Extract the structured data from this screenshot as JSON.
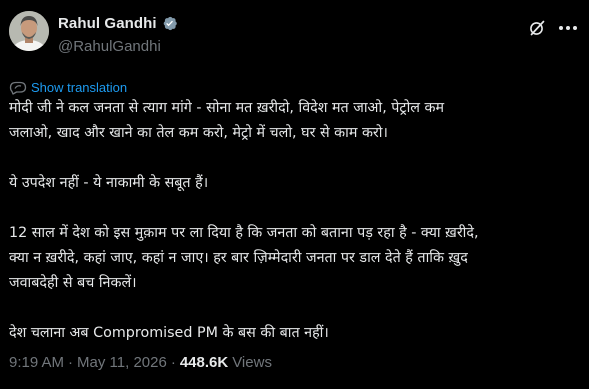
{
  "author": {
    "display_name": "Rahul Gandhi",
    "handle": "@RahulGandhi",
    "verified": true
  },
  "translate": {
    "label": "Show translation"
  },
  "tweet": {
    "lines": [
      "मोदी जी ने कल जनता से त्याग मांगे - सोना मत ख़रीदो, विदेश मत जाओ, पेट्रोल कम",
      "जलाओ, खाद और खाने का तेल कम करो, मेट्रो में चलो, घर से काम करो।",
      "",
      "ये उपदेश नहीं - ये नाकामी के सबूत हैं।",
      "",
      "12 साल में देश को इस मुक़ाम पर ला दिया है कि जनता को बताना पड़ रहा है - क्या ख़रीदे,",
      "क्या न ख़रीदे, कहां जाए, कहां न जाए। हर बार ज़िम्मेदारी जनता पर डाल देते हैं ताकि ख़ुद",
      "जवाबदेही से बच निकलें।",
      "",
      "देश चलाना अब Compromised PM के बस की बात नहीं।"
    ]
  },
  "meta": {
    "time": "9:19 AM",
    "separator": "·",
    "date": "May 11, 2026",
    "views_count": "448.6K",
    "views_label": "Views"
  },
  "colors": {
    "background": "#000000",
    "text": "#e7e9ea",
    "muted": "#71767b",
    "link": "#1d9bf0",
    "verified": "#829aab"
  },
  "icons": {
    "verified": "verified-badge-icon",
    "grok": "grok-icon",
    "more": "more-options-icon",
    "translate": "translate-icon"
  }
}
